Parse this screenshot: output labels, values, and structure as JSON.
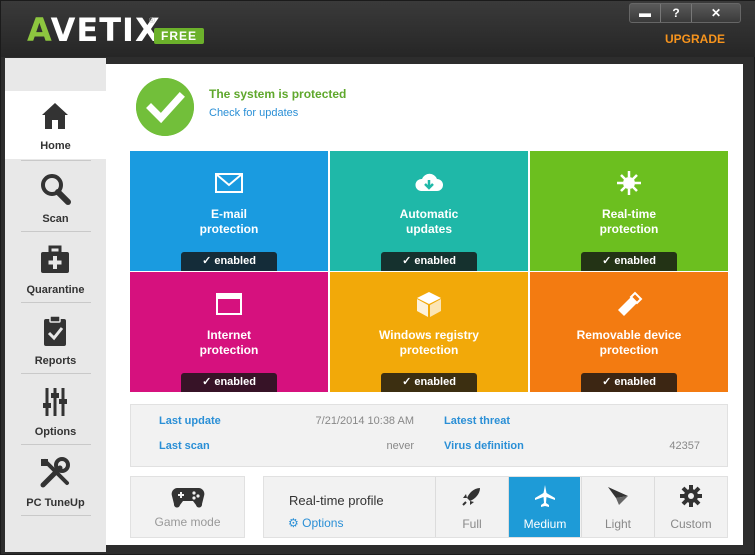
{
  "header": {
    "logo_prefix": "A",
    "logo_rest": "VETIX",
    "logo_reg": "®",
    "free_badge": "FREE",
    "window_buttons": [
      "▬",
      "?",
      "✕"
    ],
    "upgrade_label": "UPGRADE"
  },
  "sidebar": {
    "items": [
      {
        "label": "Home",
        "icon": "home-icon"
      },
      {
        "label": "Scan",
        "icon": "magnifier-icon"
      },
      {
        "label": "Quarantine",
        "icon": "medkit-icon"
      },
      {
        "label": "Reports",
        "icon": "clipboard-icon"
      },
      {
        "label": "Options",
        "icon": "sliders-icon"
      },
      {
        "label": "PC TuneUp",
        "icon": "tools-icon"
      }
    ]
  },
  "status": {
    "title": "The system is protected",
    "link": "Check for updates"
  },
  "tiles": [
    {
      "line1": "E-mail",
      "line2": "protection",
      "state": "enabled",
      "color": "#1a9be0",
      "icon": "envelope-icon"
    },
    {
      "line1": "Automatic",
      "line2": "updates",
      "state": "enabled",
      "color": "#1fb8a8",
      "icon": "cloud-download-icon"
    },
    {
      "line1": "Real-time",
      "line2": "protection",
      "state": "enabled",
      "color": "#6cbf1f",
      "icon": "virus-icon"
    },
    {
      "line1": "Internet",
      "line2": "protection",
      "state": "enabled",
      "color": "#d6117e",
      "icon": "browser-window-icon"
    },
    {
      "line1": "Windows registry",
      "line2": "protection",
      "state": "enabled",
      "color": "#f2a909",
      "icon": "cube-icon"
    },
    {
      "line1": "Removable device",
      "line2": "protection",
      "state": "enabled",
      "color": "#f37b11",
      "icon": "usb-drive-icon"
    }
  ],
  "info": {
    "last_update_label": "Last update",
    "last_update_value": "7/21/2014 10:38 AM",
    "last_scan_label": "Last scan",
    "last_scan_value": "never",
    "latest_threat_label": "Latest threat",
    "latest_threat_value": "",
    "virus_def_label": "Virus definition",
    "virus_def_value": "42357"
  },
  "game_mode": {
    "label": "Game mode",
    "icon": "gamepad-icon"
  },
  "profile": {
    "title": "Real-time profile",
    "options_link": "Options",
    "buttons": [
      {
        "label": "Full",
        "icon": "rocket-icon"
      },
      {
        "label": "Medium",
        "icon": "airplane-icon",
        "selected": true
      },
      {
        "label": "Light",
        "icon": "paper-plane-icon"
      },
      {
        "label": "Custom",
        "icon": "gear-icon"
      }
    ]
  },
  "colors": {
    "accent_green": "#72bf3a",
    "link_blue": "#2a8fd6",
    "selected_blue": "#1e9bd7",
    "upgrade_orange": "#f7941d"
  }
}
